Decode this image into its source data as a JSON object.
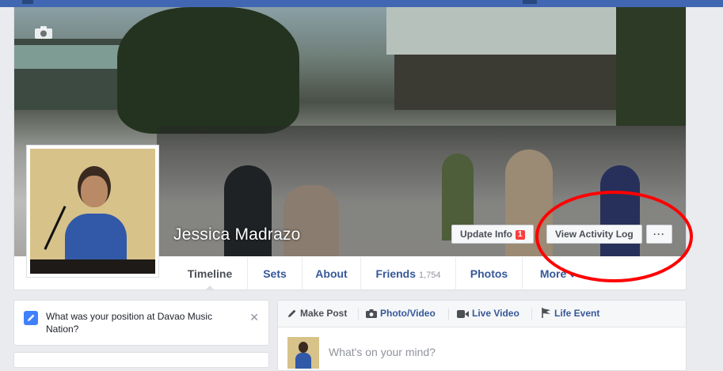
{
  "profile": {
    "name": "Jessica Madrazo",
    "update_info_label": "Update Info",
    "update_info_badge": "1",
    "activity_log_label": "View Activity Log",
    "more_options_label": "···"
  },
  "tabs": [
    {
      "label": "Timeline",
      "count": ""
    },
    {
      "label": "Sets",
      "count": ""
    },
    {
      "label": "About",
      "count": ""
    },
    {
      "label": "Friends",
      "count": "1,754"
    },
    {
      "label": "Photos",
      "count": ""
    },
    {
      "label": "More",
      "count": ""
    }
  ],
  "question_card": {
    "text": "What was your position at Davao Music Nation?",
    "close": "✕"
  },
  "composer": {
    "make_post": "Make Post",
    "photo_video": "Photo/Video",
    "live_video": "Live Video",
    "life_event": "Life Event",
    "placeholder": "What's on your mind?"
  },
  "icons": {
    "camera": "camera-icon",
    "pencil": "pencil-icon",
    "photo": "camera-icon",
    "video": "video-icon",
    "flag": "flag-icon",
    "caret": "caret-down-icon"
  },
  "colors": {
    "brand": "#4267b2",
    "link": "#365899",
    "annotation": "#ff0000",
    "badge": "#fa3e3e"
  }
}
